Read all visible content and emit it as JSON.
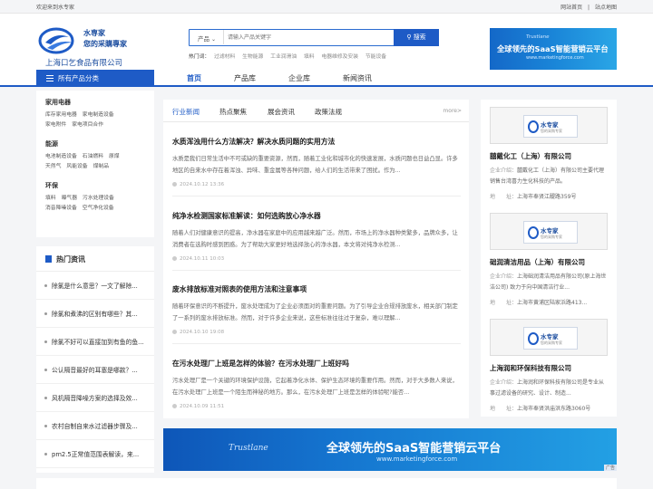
{
  "topbar": {
    "welcome": "欢迎来到水专家",
    "home": "网站首页",
    "sep": "|",
    "sitemap": "站点地图"
  },
  "logo": {
    "line1": "水専家",
    "line2": "您的采購專家",
    "company": "上海口乞食品有限公司"
  },
  "search": {
    "category": "产品",
    "placeholder": "请输入产品关键字",
    "button": "搜索"
  },
  "hot": {
    "label": "热门词：",
    "items": [
      "过滤材料",
      "生物能源",
      "工业润滑油",
      "填料",
      "电器维修及安装",
      "节能设备"
    ]
  },
  "banner_top": {
    "brand": "Trustlane",
    "headline": "全球领先的SaaS智能营销云平台",
    "url": "www.marketingforce.com"
  },
  "nav": {
    "all_categories": "所有产品分类",
    "items": [
      "首页",
      "产品库",
      "企业库",
      "新闻资讯"
    ]
  },
  "categories": [
    {
      "title": "家用电器",
      "items": [
        "库存家用电器",
        "家电制造设备",
        "家电附件",
        "家电项目合作"
      ]
    },
    {
      "title": "能源",
      "items": [
        "电池制造设备",
        "石油燃料",
        "原煤",
        "天然气",
        "风能设备",
        "煤制品"
      ]
    },
    {
      "title": "环保",
      "items": [
        "填料",
        "曝气器",
        "污水处理设备",
        "消音降噪设备",
        "空气净化设备"
      ]
    }
  ],
  "hot_news": {
    "title": "热门资讯",
    "items": [
      "除氯是什么意思？一文了解除...",
      "除氯和煮沸的区别有哪些？其...",
      "除氯不好可以直接加到有鱼的鱼...",
      "公认隔音最好的耳塞是哪款？...",
      "风机隔音降噪方案的选择及效...",
      "农村自制自来水过滤器步骤及...",
      "pm2.5正常值范围表解读，来..."
    ]
  },
  "news": {
    "tabs": [
      "行业新闻",
      "热点聚焦",
      "展会资讯",
      "政策法规"
    ],
    "more": "more>",
    "articles": [
      {
        "title": "水质浑浊用什么方法解决？解决水质问题的实用方法",
        "desc": "水质是我们日常生活中不可或缺的重要资源，然而，随着工业化和城市化的快速发展，水质问题也日益凸显。许多地区的自来水中存在着浑浊、异味、重金属等各种问题，给人们的生活带来了困扰。作为...",
        "date": "2024.10.12 13:36"
      },
      {
        "title": "纯净水检测国家标准解读：如何选购放心净水器",
        "desc": "随着人们对健康意识的提高，净水器在家庭中的应用越来越广泛。然而，市场上的净水器种类繁多，品牌众多，让消费者在选购时感到困惑。为了帮助大家更好地选择放心的净水器，本文将对纯净水检测...",
        "date": "2024.10.11 10:03"
      },
      {
        "title": "废水排放标准对照表的使用方法和注意事项",
        "desc": "随着环保意识的不断提升，废水处理成为了企业必须面对的重要问题。为了引导企业合规排放废水，相关部门制定了一系列的废水排放标准。然而，对于许多企业来说，这些标准往往过于复杂，难以理解...",
        "date": "2024.10.10 19:08"
      },
      {
        "title": "在污水处理厂上班是怎样的体验？在污水处理厂上班好吗",
        "desc": "污水处理厂是一个关键的环境保护设施，它起着净化水体、保护生态环境的重要作用。然而，对于大多数人来说，在污水处理厂上班是一个陌生而神秘的地方。那么，在污水处理厂上班是怎样的体验呢?能否...",
        "date": "2024.10.09 11:51"
      }
    ]
  },
  "companies": [
    {
      "logo_text": "水专家",
      "logo_sub": "您的采购专家",
      "name": "囍戴化工（上海）有限公司",
      "profile_label": "企业介绍：",
      "profile": "囍戴化工（上海）有限公司主要代理销售台湾喜力生化科技的产品。",
      "addr_label": "地　　址：",
      "address": "上海市奉贤江醍路359号"
    },
    {
      "logo_text": "水专家",
      "logo_sub": "您的采购专家",
      "name": "础润清洁用品（上海）有限公司",
      "profile_label": "企业介绍：",
      "profile": "上海础润清洁用品有限公司(原上海世洁公司) 致力于向中国清洁行业...",
      "addr_label": "地　　址：",
      "address": "上海市黄浦区陆家浜路413..."
    },
    {
      "logo_text": "水专家",
      "logo_sub": "您的采购专家",
      "name": "上海润和环保科技有限公司",
      "profile_label": "企业介绍：",
      "profile": "上海润和环保科技有限公司是专业从事过滤设备的研究、设计、制造...",
      "addr_label": "地　　址：",
      "address": "上海市奉贤洪庙洪东路3060号"
    }
  ],
  "banner_bottom": {
    "brand": "Trustlane",
    "headline": "全球领先的SaaS智能营销云平台",
    "url": "www.marketingforce.com",
    "ad": "广告"
  }
}
